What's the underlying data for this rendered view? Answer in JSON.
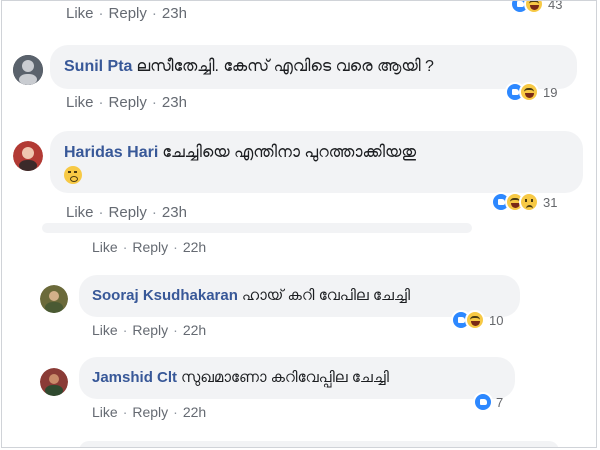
{
  "actions": {
    "like": "Like",
    "reply": "Reply"
  },
  "comments": [
    {
      "id": "top-partial",
      "time": "23h",
      "reaction_count": "43"
    },
    {
      "id": "sunil",
      "author": "Sunil Pta",
      "text": "ലസീതേച്ചി. കേസ് എവിടെ വരെ ആയി ?",
      "time": "23h",
      "reaction_count": "19",
      "reactions": [
        "like-icon",
        "haha-icon"
      ]
    },
    {
      "id": "haridas",
      "author": "Haridas Hari",
      "text": "ചേച്ചിയെ എന്തിനാ പുറത്താക്കിയതു",
      "time": "23h",
      "reaction_count": "31",
      "reactions": [
        "like-icon",
        "haha-icon",
        "sad-icon"
      ],
      "inline_emoji": "thinking-face"
    },
    {
      "id": "reply-partial",
      "time": "22h"
    },
    {
      "id": "sooraj",
      "author": "Sooraj Ksudhakaran",
      "text": "ഹായ് കറി വേപില ചേച്ചി",
      "time": "22h",
      "reaction_count": "10",
      "reactions": [
        "like-icon",
        "haha-icon"
      ]
    },
    {
      "id": "jamshid",
      "author": "Jamshid Clt",
      "text": "സുഖമാണോ കറിവേപ്പില ചേച്ചി",
      "time": "22h",
      "reaction_count": "7",
      "reactions": [
        "like-icon"
      ]
    }
  ],
  "colors": {
    "author": "#385898",
    "bubble": "#f2f3f5",
    "like": "#2d88ff",
    "meta": "#656a72"
  }
}
